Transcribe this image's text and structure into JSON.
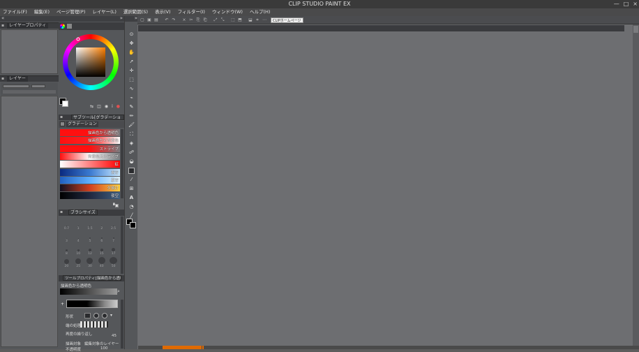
{
  "window": {
    "title": "CLIP STUDIO PAINT EX",
    "min": "—",
    "max": "□",
    "close": "×"
  },
  "menu": [
    "ファイル(F)",
    "編集(E)",
    "ページ管理(P)",
    "レイヤー(L)",
    "選択範囲(S)",
    "表示(V)",
    "フィルター(I)",
    "ウィンドウ(W)",
    "ヘルプ(H)"
  ],
  "panels": {
    "layer_property": {
      "tab": "レイヤープロパティ"
    },
    "layer": {
      "tab": "レイヤー"
    },
    "gradient_outer_tab": "サブツール[グラデーション]",
    "gradient_tab": "グラデーション",
    "brush_size_tab": "ブラシサイズ",
    "tool_property_tab": "ツールプロパティ[描画色から透明色]"
  },
  "gradients": [
    {
      "label": "描画色から透明色",
      "stops": [
        "#ff1010",
        "#ff1010",
        "#7a7b7e"
      ]
    },
    {
      "label": "描画色から背景色",
      "stops": [
        "#ff1010",
        "#ff2020",
        "#ffffff"
      ]
    },
    {
      "label": "ストライプ",
      "stops": [
        "#ff1010",
        "#ff1010",
        "#7a7b7e"
      ]
    },
    {
      "label": "背景色ストライプ",
      "stops": [
        "#ff1010",
        "#ffffff",
        "#7a7b7e"
      ]
    },
    {
      "label": "虹",
      "stops": [
        "#ffffff",
        "#ff8080",
        "#ff0000"
      ]
    },
    {
      "label": "青空",
      "stops": [
        "#0a2a80",
        "#3a7ad0",
        "#c8e8ff"
      ]
    },
    {
      "label": "夏空",
      "stops": [
        "#2060c0",
        "#60b0ff",
        "#e0f4ff"
      ]
    },
    {
      "label": "夕焼け",
      "stops": [
        "#101020",
        "#d04020",
        "#ffd040"
      ]
    },
    {
      "label": "夜空",
      "stops": [
        "#000000",
        "#202840",
        "#406080"
      ]
    }
  ],
  "brush_sizes": [
    {
      "num": "0.7",
      "d": 1
    },
    {
      "num": "1",
      "d": 1
    },
    {
      "num": "1.5",
      "d": 1
    },
    {
      "num": "2",
      "d": 1
    },
    {
      "num": "2.5",
      "d": 1
    },
    {
      "num": "3",
      "d": 1
    },
    {
      "num": "4",
      "d": 1
    },
    {
      "num": "5",
      "d": 2
    },
    {
      "num": "6",
      "d": 2
    },
    {
      "num": "7",
      "d": 2
    },
    {
      "num": "8",
      "d": 3
    },
    {
      "num": "10",
      "d": 3
    },
    {
      "num": "12",
      "d": 4
    },
    {
      "num": "15",
      "d": 4
    },
    {
      "num": "17",
      "d": 5
    },
    {
      "num": "20",
      "d": 7
    },
    {
      "num": "25",
      "d": 8
    },
    {
      "num": "30",
      "d": 9
    },
    {
      "num": "40",
      "d": 10
    },
    {
      "num": "50",
      "d": 11
    }
  ],
  "tool_property": {
    "preset_label": "描画色から透明色",
    "shape_label": "形状",
    "edge_label": "端の処理",
    "repeat_label": "再度の繰り返し",
    "value1": "45",
    "target_label": "描画対象",
    "target_value": "編集対象のレイヤー",
    "opacity_label": "不透明度",
    "opacity_value": "100"
  },
  "cmd": {
    "home_button": "CLIPホームページ"
  },
  "colors": {
    "fg": "#000000",
    "bg": "#ffffff"
  },
  "icons": [
    "new-file-icon",
    "open-file-icon",
    "save-icon",
    "undo-icon",
    "redo-icon",
    "clear-icon",
    "cut-icon",
    "copy-icon",
    "paste-icon",
    "transform-icon"
  ]
}
